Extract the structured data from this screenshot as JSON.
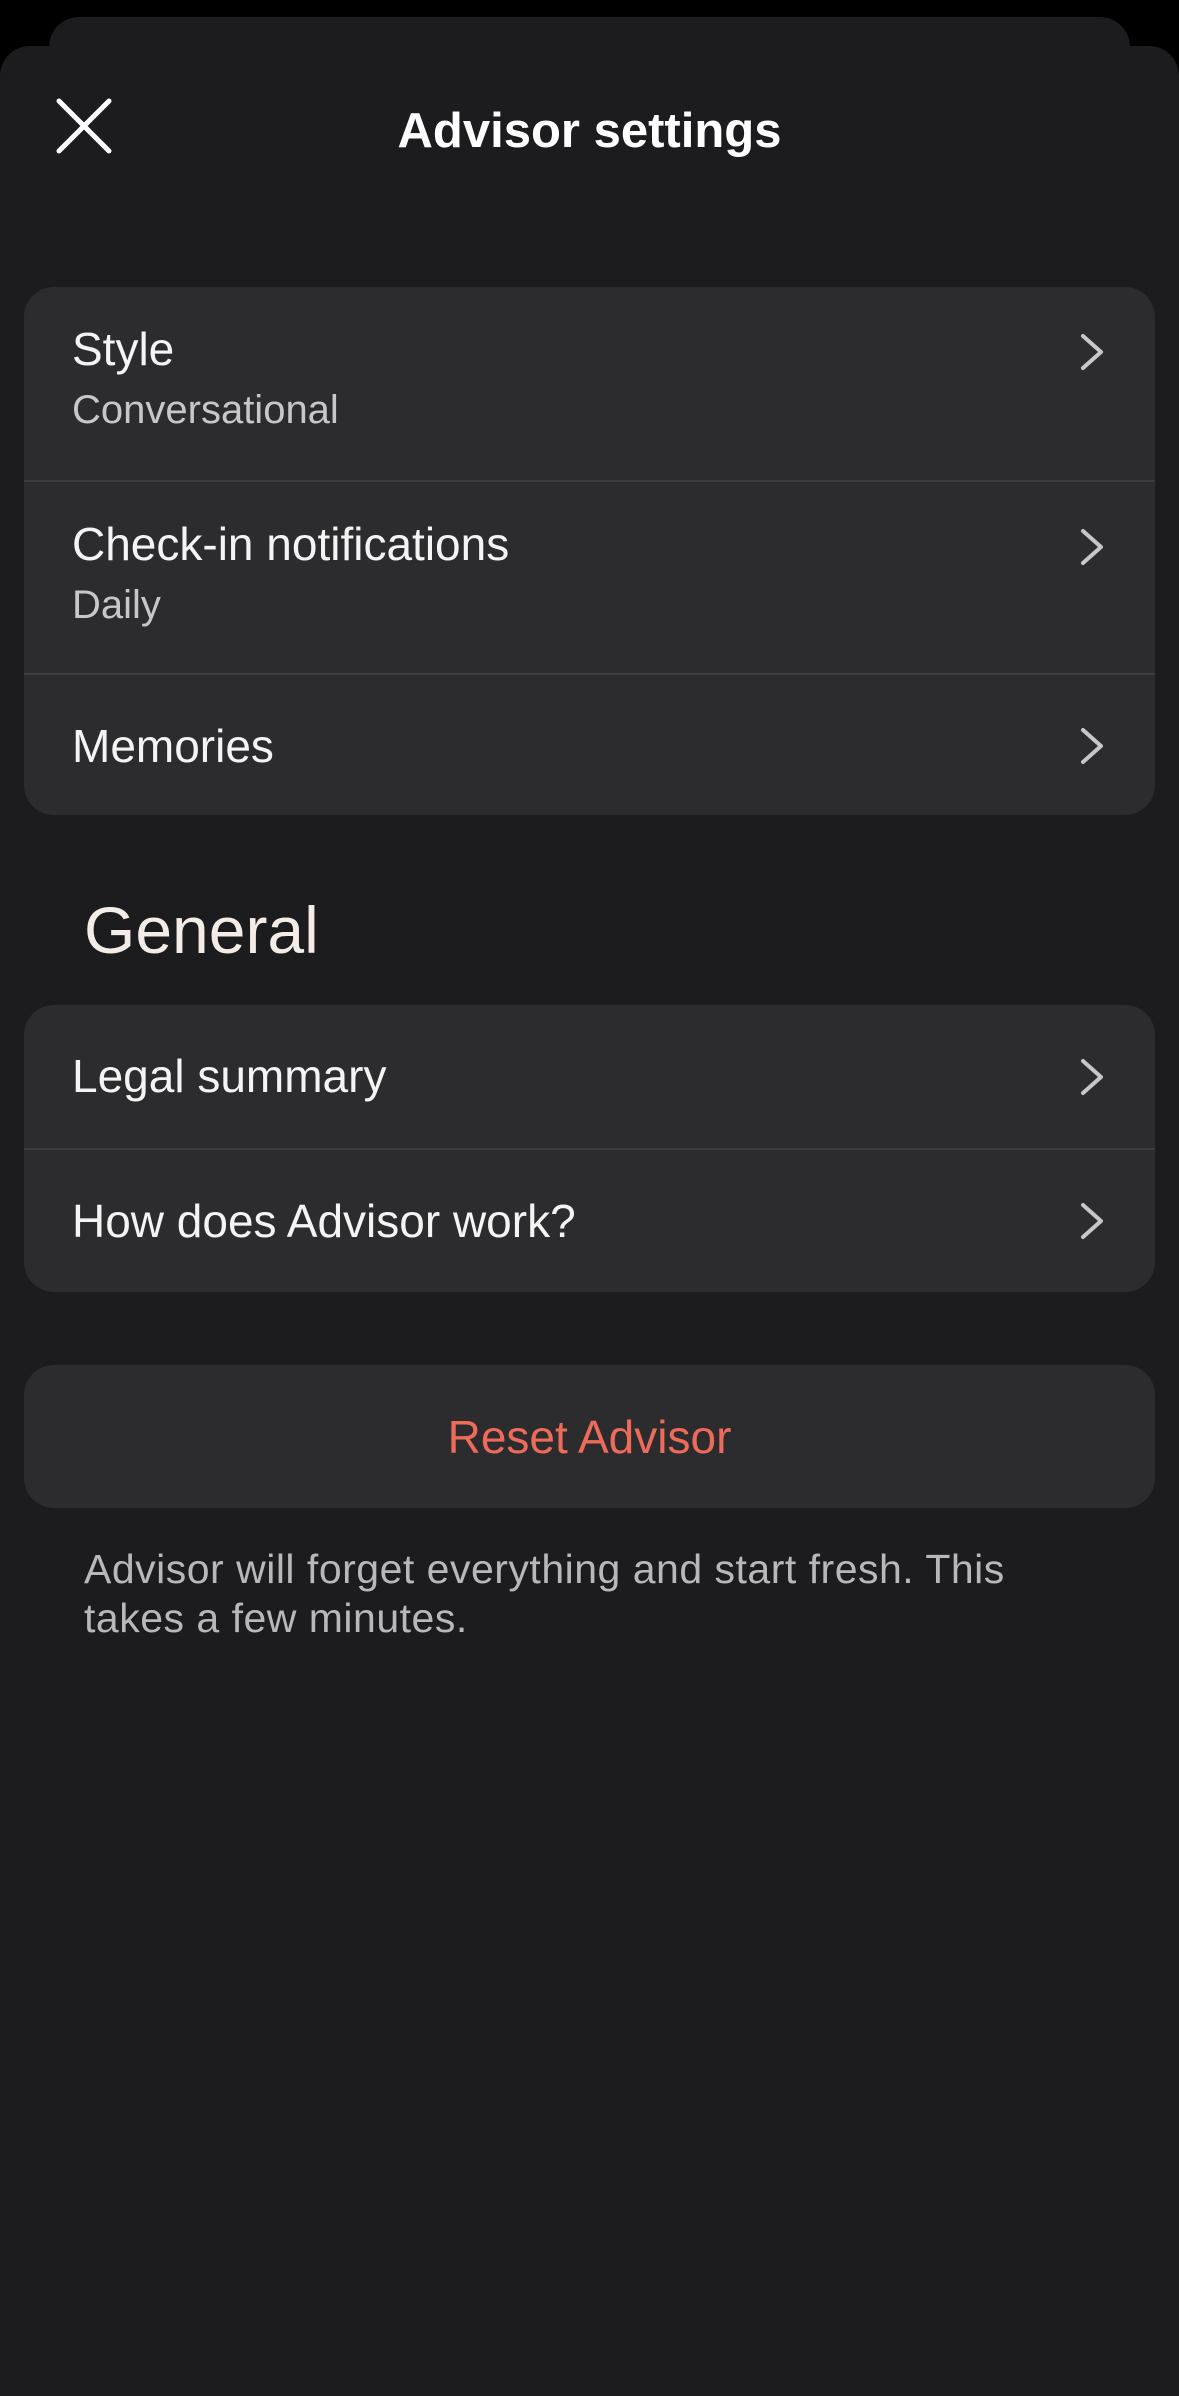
{
  "header": {
    "title": "Advisor settings",
    "close_icon": "close-icon"
  },
  "advisor_group": {
    "items": [
      {
        "label": "Style",
        "value": "Conversational"
      },
      {
        "label": "Check-in notifications",
        "value": "Daily"
      },
      {
        "label": "Memories"
      }
    ]
  },
  "general": {
    "heading": "General",
    "items": [
      {
        "label": "Legal summary"
      },
      {
        "label": "How does Advisor work?"
      }
    ]
  },
  "reset": {
    "label": "Reset Advisor",
    "description": "Advisor will forget everything and start fresh. This takes a few minutes."
  },
  "colors": {
    "background": "#1c1c1e",
    "card": "#2c2c2e",
    "destructive": "#ec6b5b"
  },
  "icons": {
    "chevron": "chevron-right-icon"
  }
}
